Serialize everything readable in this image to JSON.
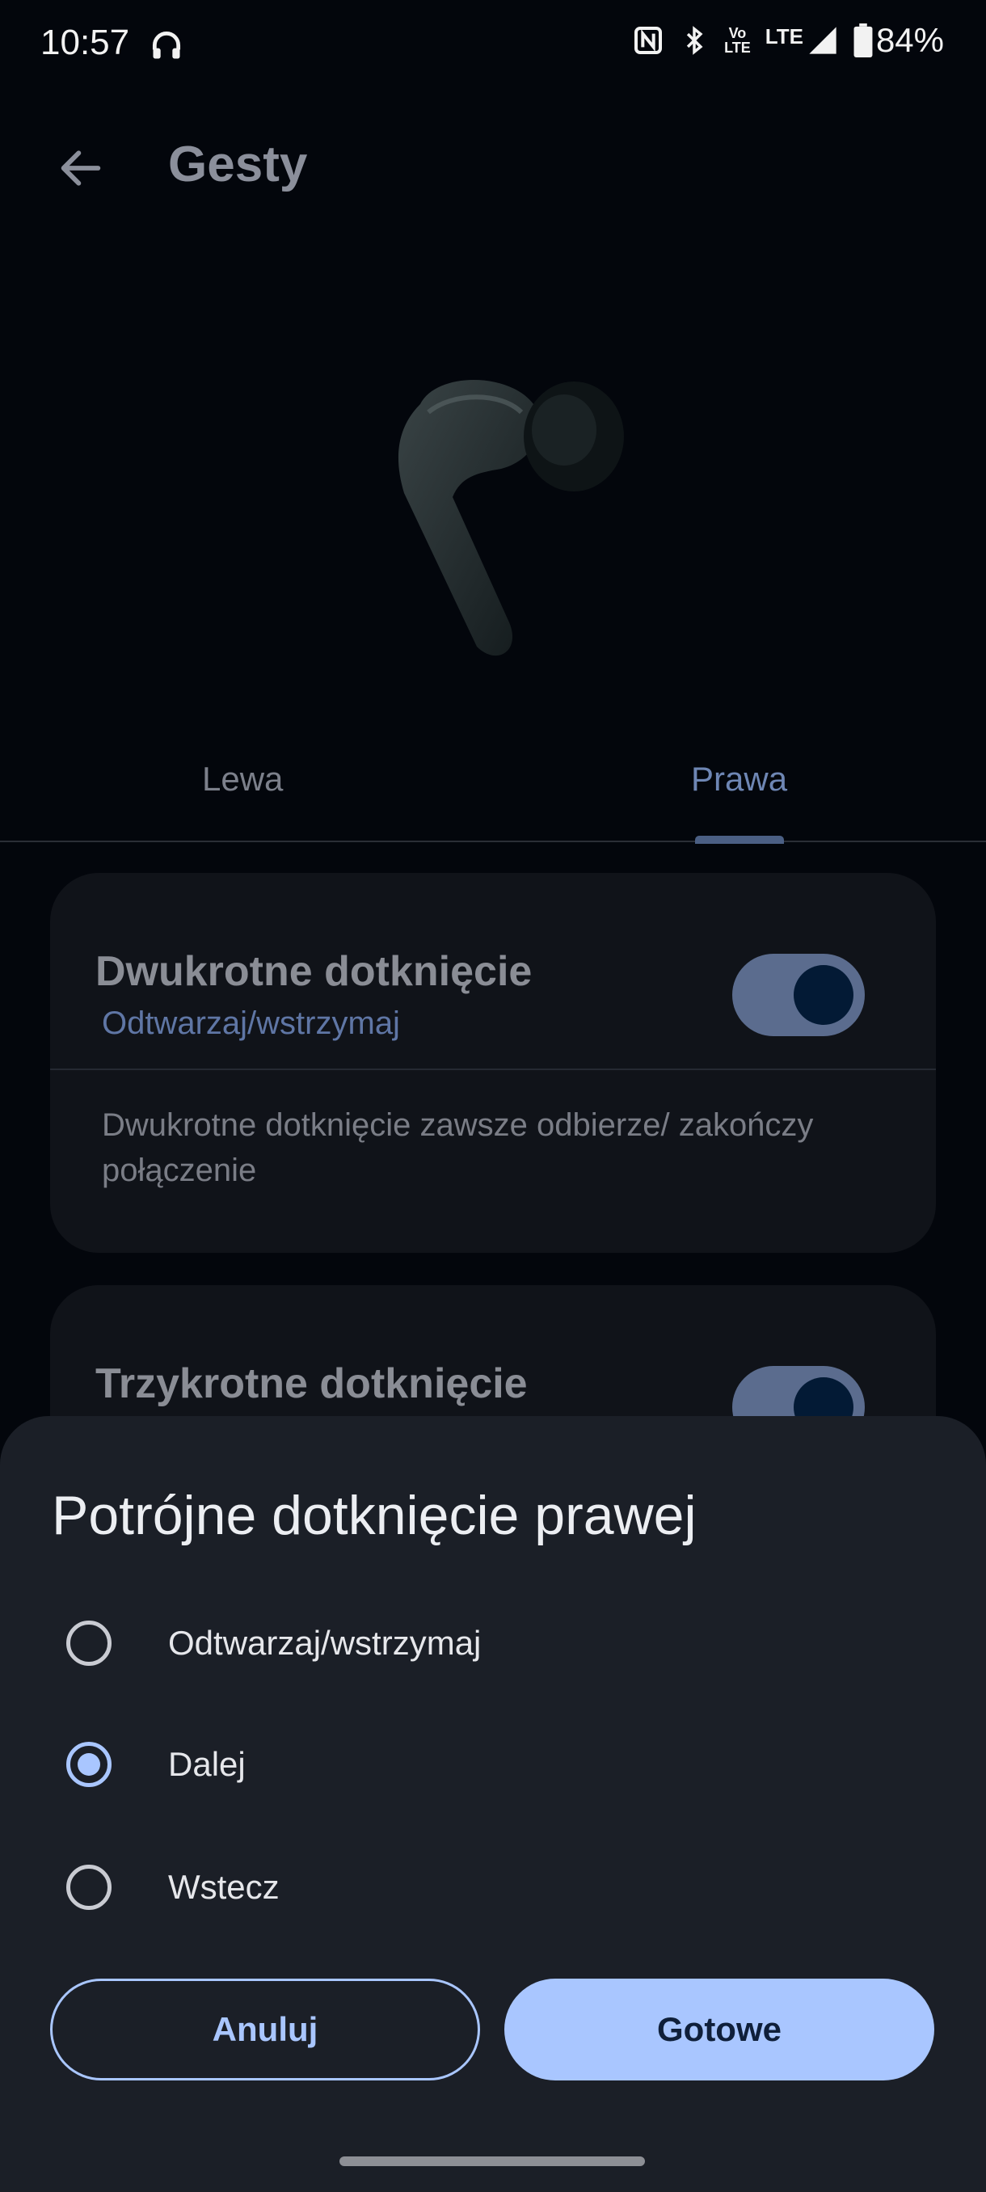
{
  "status_bar": {
    "time": "10:57",
    "volte_top": "Vo",
    "volte_bottom": "LTE",
    "lte": "LTE",
    "battery": "84%",
    "icons": [
      "headphones-icon",
      "nfc-icon",
      "bluetooth-icon",
      "volte-icon",
      "signal-icon",
      "battery-icon"
    ]
  },
  "header": {
    "title": "Gesty"
  },
  "tabs": [
    {
      "label": "Lewa",
      "selected": false
    },
    {
      "label": "Prawa",
      "selected": true
    }
  ],
  "cards": [
    {
      "title": "Dwukrotne dotknięcie",
      "subtitle": "Odtwarzaj/wstrzymaj",
      "description": "Dwukrotne dotknięcie zawsze odbierze/ zakończy połączenie",
      "enabled": true
    },
    {
      "title": "Trzykrotne dotknięcie",
      "enabled": true
    }
  ],
  "sheet": {
    "title": "Potrójne dotknięcie prawej",
    "options": [
      {
        "label": "Odtwarzaj/wstrzymaj",
        "selected": false
      },
      {
        "label": "Dalej",
        "selected": true
      },
      {
        "label": "Wstecz",
        "selected": false
      }
    ],
    "cancel_label": "Anuluj",
    "done_label": "Gotowe"
  },
  "colors": {
    "accent": "#a9c6ff",
    "background": "#03060c",
    "sheet": "#1b1f27"
  }
}
